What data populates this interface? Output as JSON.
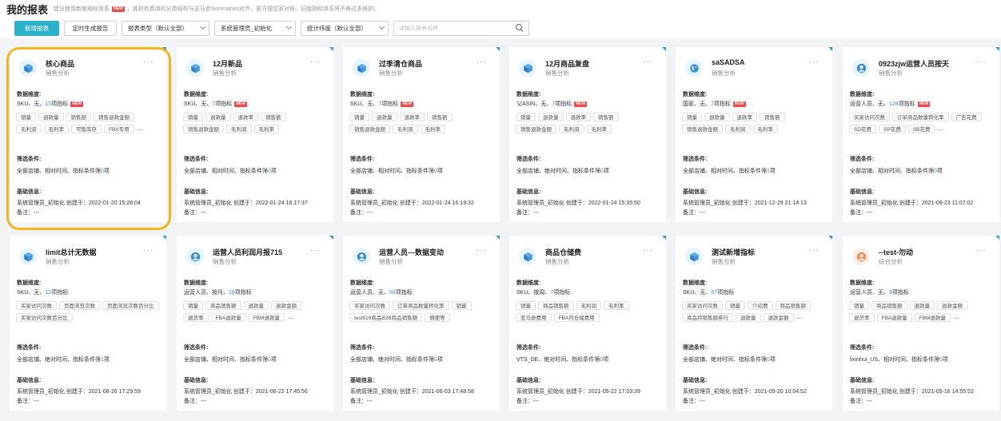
{
  "header": {
    "title": "我的报表",
    "tip_before": "建议使用新版指标体系",
    "tip_badge": "NEW",
    "tip_after": "，其财务费用的分类结构与亚马逊Summaries对齐，更方便您家对账。旧版指标体系将不再过多维护。"
  },
  "toolbar": {
    "add_label": "新增报表",
    "schedule_label": "定时生成报告",
    "filters": [
      {
        "label": "报表类型（默认全部）"
      },
      {
        "label": "系统管理员_初始化"
      },
      {
        "label": "统计纬度（默认全部）"
      }
    ],
    "search_placeholder": "请输入报表名称"
  },
  "labels": {
    "dimension": "数据维度:",
    "filter": "筛选条件:",
    "basic": "基础信息:",
    "more": "···",
    "ellipsis": "..."
  },
  "colors": {
    "primary": "#2bb2c9",
    "highlight": "#f2b51c",
    "new_badge": "#f04848",
    "link_number": "#3a8fd5"
  },
  "cards": [
    {
      "name": "核心商品",
      "subtype": "销售分析",
      "icon": "cube-icon",
      "dim_prefix": "SKU、无、",
      "dim_num": "15",
      "dim_suffix": "项指标",
      "dim_new": "NEW",
      "tags": [
        "销量",
        "退款量",
        "销售额",
        "销售退款金额",
        "毛利润",
        "毛利率",
        "可售库存",
        "FBA专用"
      ],
      "tags_more": true,
      "filter_prefix": "全部店铺、相对时间、指标条件筛",
      "filter_num": "0",
      "filter_suffix": "项",
      "creator": "系统管理员_初始化 创建于：2022-01-20 15:28:04",
      "remark": "备注：---"
    },
    {
      "name": "12月新品",
      "subtype": "销售分析",
      "icon": "cube-icon",
      "dim_prefix": "SKU、无、",
      "dim_num": "7",
      "dim_suffix": "项指标",
      "dim_new": "NEW",
      "tags": [
        "销量",
        "退款量",
        "退款率",
        "销售额",
        "销售退款金额",
        "毛利润",
        "毛利率"
      ],
      "tags_more": false,
      "filter_prefix": "全部店铺、相对时间、指标条件筛",
      "filter_num": "0",
      "filter_suffix": "项",
      "creator": "系统管理员_初始化 创建于：2022-01-24 16:17:37",
      "remark": "备注：---"
    },
    {
      "name": "过季清仓商品",
      "subtype": "销售分析",
      "icon": "cube-icon",
      "dim_prefix": "SKU、无、",
      "dim_num": "7",
      "dim_suffix": "项指标",
      "dim_new": "NEW",
      "tags": [
        "销量",
        "退款量",
        "退款率",
        "销售额",
        "销售退款金额",
        "毛利润",
        "毛利率"
      ],
      "tags_more": false,
      "filter_prefix": "全部店铺、相对时间、指标条件筛",
      "filter_num": "0",
      "filter_suffix": "项",
      "creator": "系统管理员_初始化 创建于：2022-01-24 16:19:32",
      "remark": "备注：---"
    },
    {
      "name": "12月商品复盘",
      "subtype": "销售分析",
      "icon": "cube-icon",
      "dim_prefix": "父ASIN、无、",
      "dim_num": "7",
      "dim_suffix": "项指标",
      "dim_new": "NEW",
      "tags": [
        "销量",
        "退款量",
        "退款率",
        "销售额",
        "销售退款金额",
        "毛利润",
        "毛利率"
      ],
      "tags_more": false,
      "filter_prefix": "全部店铺、绝对时间、指标条件筛",
      "filter_num": "0",
      "filter_suffix": "项",
      "creator": "系统管理员_初始化 创建于：2022-01-24 15:35:50",
      "remark": "备注：---"
    },
    {
      "name": "saSADSA",
      "subtype": "销售分析",
      "icon": "globe-icon",
      "dim_prefix": "国家、无、",
      "dim_num": "7",
      "dim_suffix": "项指标",
      "dim_new": "NEW",
      "tags": [
        "销量",
        "退款量",
        "退款率",
        "销售额",
        "销售退款金额",
        "毛利润",
        "毛利率"
      ],
      "tags_more": false,
      "filter_prefix": "全部店铺、相对时间、指标条件筛",
      "filter_num": "1",
      "filter_suffix": "项",
      "creator": "系统管理员_初始化 创建于：2021-12-29 21:14:13",
      "remark": "备注：---"
    },
    {
      "name": "0923zjw运营人员按天",
      "subtype": "销售分析",
      "icon": "user-icon",
      "dim_prefix": "运营人员、无、",
      "dim_num": "128",
      "dim_suffix": "项指标",
      "dim_new": "NEW",
      "tags": [
        "买家访问次数",
        "订单商品数量转化率",
        "广告花费",
        "SD花费",
        "SP花费",
        "SB花费"
      ],
      "tags_more": true,
      "filter_prefix": "全部店铺、相对时间、指标条件筛",
      "filter_num": "0",
      "filter_suffix": "项",
      "creator": "系统管理员_初始化 创建于：2021-09-23 11:07:02",
      "remark": "备注：---"
    },
    {
      "name": "limit总计无数据",
      "subtype": "销售分析",
      "icon": "cube-icon",
      "dim_prefix": "SKU、无、",
      "dim_num": "12",
      "dim_suffix": "项指标",
      "dim_new": "",
      "tags": [
        "买家访问次数",
        "页面浏览次数",
        "页面浏览次数百分比",
        "买家访问次数百分比"
      ],
      "tags_more": false,
      "filter_prefix": "全部店铺、绝对时间、指标条件筛",
      "filter_num": "1",
      "filter_suffix": "项",
      "creator": "系统管理员_初始化 创建于：2021-08-26 17:29:59",
      "remark": "备注：---"
    },
    {
      "name": "运营人员利润月报715",
      "subtype": "销售分析",
      "icon": "user-icon",
      "dim_prefix": "运营人员、按月、",
      "dim_num": "18",
      "dim_suffix": "项指标",
      "dim_new": "",
      "tags": [
        "销量",
        "商品销售额",
        "退款量",
        "退款金额",
        "退货率",
        "FBA退款量",
        "FBM退款量"
      ],
      "tags_more": true,
      "filter_prefix": "全部店铺、相对时间、指标条件筛",
      "filter_num": "0",
      "filter_suffix": "项",
      "creator": "系统管理员_初始化 创建于：2021-06-22 17:45:56",
      "remark": "备注：---"
    },
    {
      "name": "运营人员---数据变动",
      "subtype": "销售分析",
      "icon": "user-icon",
      "dim_prefix": "运营人员、无、",
      "dim_num": "68",
      "dim_suffix": "项指标",
      "dim_new": "",
      "tags": [
        "买家访问次数",
        "订单商品数量转化率",
        "销量",
        "test519商品B2B商品销售额",
        "佣使等"
      ],
      "tags_more": false,
      "filter_prefix": "全部店铺、绝对时间、指标条件筛",
      "filter_num": "0",
      "filter_suffix": "项",
      "creator": "系统管理员_初始化 创建于：2021-06-03 17:48:58",
      "remark": "备注：---"
    },
    {
      "name": "商品仓储费",
      "subtype": "销售分析",
      "icon": "cube-icon",
      "dim_prefix": "SKU、按周、",
      "dim_num": "7",
      "dim_suffix": "项指标",
      "dim_new": "",
      "tags": [
        "销量",
        "商品销售额",
        "毛利润",
        "毛利率",
        "亚马逊费用",
        "FBA月仓储费用"
      ],
      "tags_more": false,
      "filter_prefix": "VTS_DE、绝对时间、指标条件筛",
      "filter_num": "0",
      "filter_suffix": "项",
      "creator": "系统管理员_初始化 创建于：2021-05-22 17:03:39",
      "remark": "备注：---"
    },
    {
      "name": "测试新增指标",
      "subtype": "销售分析",
      "icon": "cube-icon",
      "dim_prefix": "SKU、无、",
      "dim_num": "67",
      "dim_suffix": "项指标",
      "dim_new": "",
      "tags": [
        "买家访问次数",
        "销量",
        "介绍费",
        "商品销售额",
        "商品月销售额排行",
        "退款量",
        "退款金额"
      ],
      "tags_more": true,
      "filter_prefix": "全部店铺、绝对时间、指标条件筛",
      "filter_num": "0",
      "filter_suffix": "项",
      "creator": "系统管理员_初始化 创建于：2021-05-20 10:04:52",
      "remark": "备注：---"
    },
    {
      "name": "--test-勿动",
      "subtype": "综合分析",
      "icon": "user-orange-icon",
      "dim_prefix": "运营人员、无、",
      "dim_num": "9",
      "dim_suffix": "项指标",
      "dim_new": "",
      "tags": [
        "销量",
        "商品销售额",
        "退款量",
        "退款金额",
        "退货率",
        "FBA退款量",
        "FBM退款量"
      ],
      "tags_more": true,
      "filter_prefix": "lixinhui_US、相对时间、指标条件筛",
      "filter_num": "0",
      "filter_suffix": "项",
      "creator": "系统管理员_初始化 创建于：2021-05-16 14:55:52",
      "remark": "备注：---"
    }
  ]
}
